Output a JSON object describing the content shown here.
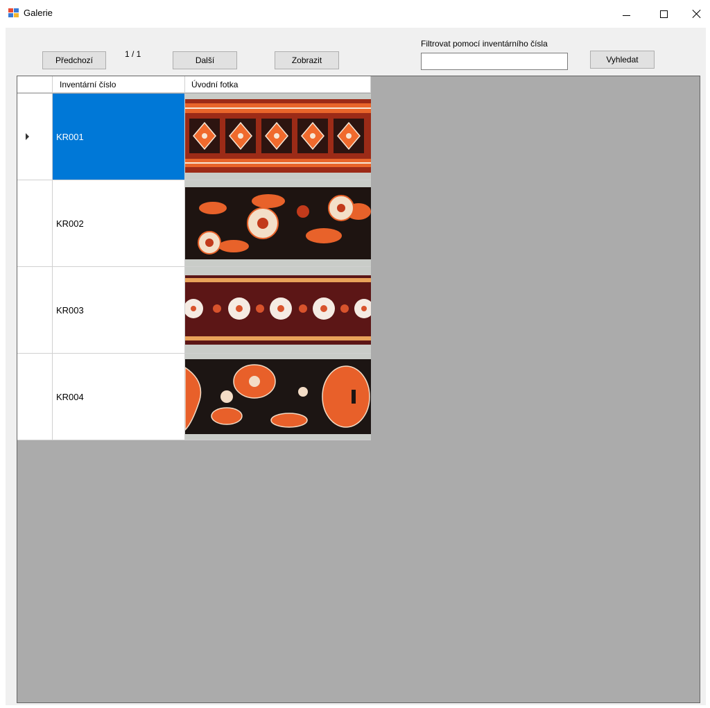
{
  "window": {
    "title": "Galerie",
    "icon": "app-window-icon",
    "controls": [
      "minimize-icon",
      "maximize-icon",
      "close-icon"
    ]
  },
  "toolbar": {
    "prev_label": "Předchozí",
    "page_label": "1 / 1",
    "next_label": "Další",
    "show_label": "Zobrazit",
    "filter_label": "Filtrovat pomocí inventárního čísla",
    "filter_value": "",
    "search_label": "Vyhledat"
  },
  "grid": {
    "columns": [
      "Inventární číslo",
      "Úvodní fotka"
    ],
    "rows": [
      {
        "inventory_number": "KR001",
        "photo": "embroidery-photo",
        "selected": true
      },
      {
        "inventory_number": "KR002",
        "photo": "embroidery-photo",
        "selected": false
      },
      {
        "inventory_number": "KR003",
        "photo": "embroidery-photo",
        "selected": false
      },
      {
        "inventory_number": "KR004",
        "photo": "embroidery-photo",
        "selected": false
      }
    ]
  },
  "colors": {
    "selection": "#0078d7",
    "grid_background": "#ababab",
    "form_background": "#f0f0f0",
    "button_face": "#e1e1e1"
  }
}
